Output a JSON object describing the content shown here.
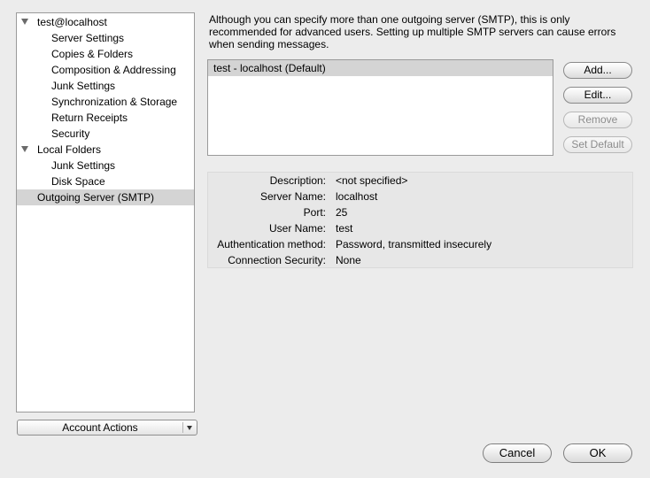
{
  "tree": {
    "items": [
      {
        "label": "test@localhost",
        "expanded": true
      },
      {
        "label": "Server Settings"
      },
      {
        "label": "Copies & Folders"
      },
      {
        "label": "Composition & Addressing"
      },
      {
        "label": "Junk Settings"
      },
      {
        "label": "Synchronization & Storage"
      },
      {
        "label": "Return Receipts"
      },
      {
        "label": "Security"
      },
      {
        "label": "Local Folders",
        "expanded": true
      },
      {
        "label": "Junk Settings"
      },
      {
        "label": "Disk Space"
      },
      {
        "label": "Outgoing Server (SMTP)",
        "selected": true
      }
    ]
  },
  "account_actions": {
    "label": "Account Actions"
  },
  "intro_text": "Although you can specify more than one outgoing server (SMTP), this is only recommended for advanced users. Setting up multiple SMTP servers can cause errors when sending messages.",
  "servers": [
    {
      "label": "test - localhost (Default)",
      "selected": true
    }
  ],
  "buttons": {
    "add": "Add...",
    "edit": "Edit...",
    "remove": "Remove",
    "set_default": "Set Default"
  },
  "details": [
    {
      "key": "Description:",
      "value": "<not specified>"
    },
    {
      "key": "Server Name:",
      "value": "localhost"
    },
    {
      "key": "Port:",
      "value": "25"
    },
    {
      "key": "User Name:",
      "value": "test"
    },
    {
      "key": "Authentication method:",
      "value": "Password, transmitted insecurely"
    },
    {
      "key": "Connection Security:",
      "value": "None"
    }
  ],
  "dialog": {
    "cancel": "Cancel",
    "ok": "OK"
  }
}
